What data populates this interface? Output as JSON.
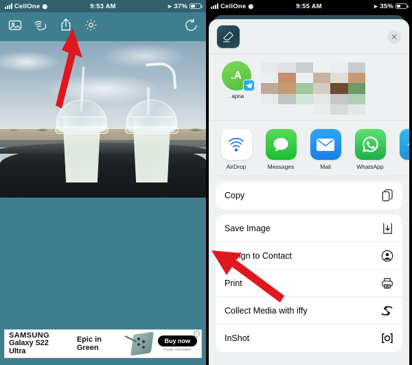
{
  "left": {
    "status": {
      "carrier": "CellOne",
      "time": "9:53 AM",
      "battery": "37%",
      "wifi_icon": "wifi-icon",
      "location_icon": "location-arrow-icon",
      "signal_icon": "signal-bars-icon",
      "battery_icon": "battery-icon"
    },
    "toolbar": {
      "gallery": "gallery-icon",
      "touch": "hand-touch-icon",
      "share": "share-icon",
      "settings": "gear-icon",
      "undo": "undo-icon"
    },
    "photo": {
      "alt": "two clear plastic cups with domed lids and straws on a car dashboard"
    },
    "ad": {
      "brand_line1": "SAMSUNG",
      "brand_line2": "Galaxy S22 Ultra",
      "tagline": "Epic in Green",
      "cta": "Buy now",
      "note": "Image simulated",
      "info_icon": "ⓘ"
    },
    "arrow": {
      "name": "annotation-arrow-share",
      "color": "#ec1c24"
    }
  },
  "right": {
    "status": {
      "carrier": "CellOne",
      "time": "9:55 AM",
      "battery": "35%"
    },
    "sheet": {
      "app_icon": "eraser-icon",
      "close": "✕",
      "contact": {
        "initials": ".A",
        "name": ". apna",
        "badge": "telegram-icon"
      },
      "preview": "blurred-image-thumbnail",
      "apps": [
        {
          "label": "AirDrop",
          "icon": "airdrop-icon"
        },
        {
          "label": "Messages",
          "icon": "messages-icon"
        },
        {
          "label": "Mail",
          "icon": "mail-icon"
        },
        {
          "label": "WhatsApp",
          "icon": "whatsapp-icon"
        },
        {
          "label": "Te",
          "icon": "telegram-icon"
        }
      ],
      "groups": [
        {
          "rows": [
            {
              "label": "Copy",
              "icon": "copy-icon"
            }
          ]
        },
        {
          "rows": [
            {
              "label": "Save Image",
              "icon": "save-download-icon"
            },
            {
              "label": "Assign to Contact",
              "icon": "contact-circle-icon"
            },
            {
              "label": "Print",
              "icon": "printer-icon"
            },
            {
              "label": "Collect Media with iffy",
              "icon": "collect-media-icon"
            },
            {
              "label": "InShot",
              "icon": "inshot-icon"
            }
          ]
        }
      ]
    },
    "arrow": {
      "name": "annotation-arrow-save-image",
      "color": "#e0171f"
    }
  },
  "colors": {
    "app_teal": "#3f7e8e",
    "statusbar_teal": "#32606f",
    "arrow_red": "#e0171f",
    "sheet_bg": "#eef1f2"
  }
}
